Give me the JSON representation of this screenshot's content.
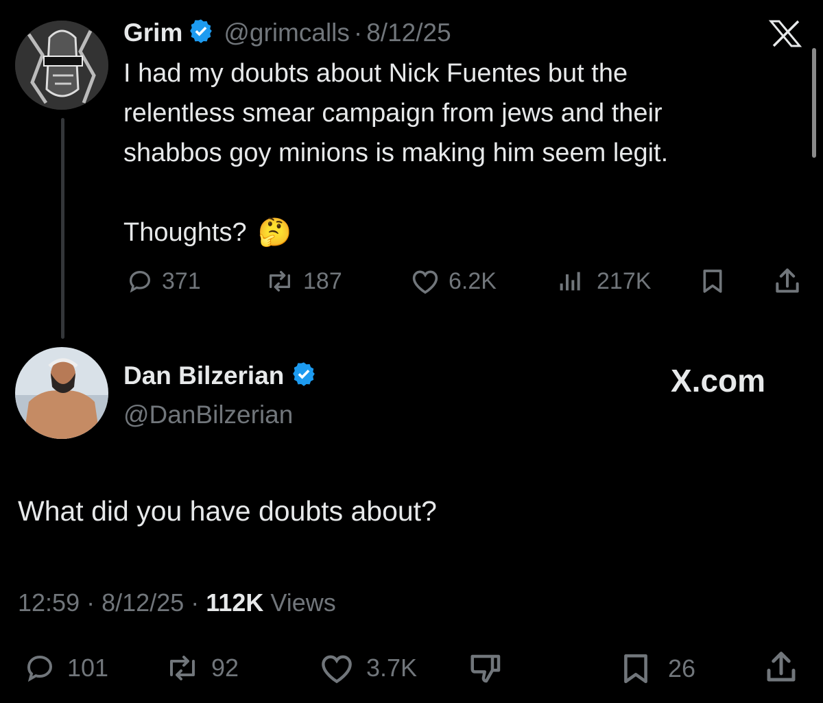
{
  "parent_tweet": {
    "author_name": "Grim",
    "handle": "@grimcalls",
    "separator": "·",
    "date": "8/12/25",
    "text_lines": [
      "I had my doubts about Nick Fuentes but the",
      "relentless smear campaign from jews and their",
      "shabbos goy minions is making him seem legit."
    ],
    "text_followup": "Thoughts?",
    "emoji": "🤔",
    "stats": {
      "replies": "371",
      "reposts": "187",
      "likes": "6.2K",
      "views": "217K"
    }
  },
  "reply_tweet": {
    "author_name": "Dan Bilzerian",
    "handle": "@DanBilzerian",
    "brand_label": "X.com",
    "text": "What did you have doubts about?",
    "time": "12:59",
    "date": "8/12/25",
    "separator": "·",
    "views_count": "112K",
    "views_label": "Views",
    "stats": {
      "replies": "101",
      "reposts": "92",
      "likes": "3.7K",
      "bookmarks": "26"
    }
  },
  "colors": {
    "background": "#000000",
    "text": "#e7e9ea",
    "muted": "#71767b",
    "verified": "#1d9bf0"
  },
  "icons": [
    "x-logo-icon",
    "verified-badge-icon",
    "reply-icon",
    "repost-icon",
    "like-icon",
    "views-icon",
    "bookmark-icon",
    "share-icon",
    "dislike-icon"
  ]
}
